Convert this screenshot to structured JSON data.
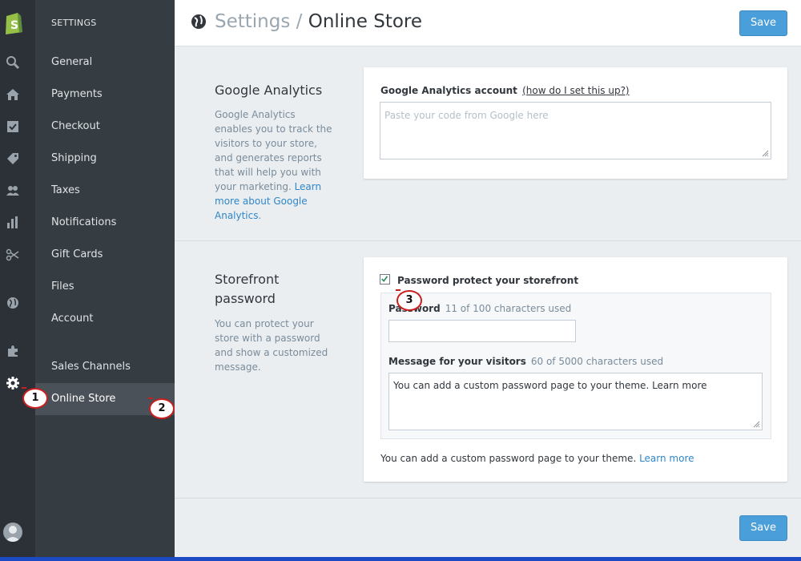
{
  "rail": {
    "icons": [
      "search-icon",
      "home-icon",
      "orders-icon",
      "tag-icon",
      "customers-icon",
      "reports-icon",
      "discounts-icon",
      "globe-icon",
      "puzzle-icon",
      "gear-icon"
    ]
  },
  "nav": {
    "heading": "SETTINGS",
    "items": [
      "General",
      "Payments",
      "Checkout",
      "Shipping",
      "Taxes",
      "Notifications",
      "Gift Cards",
      "Files",
      "Account"
    ],
    "channels_label": "Sales Channels",
    "active_item": "Online Store"
  },
  "header": {
    "crumb_parent": "Settings",
    "crumb_sep": " / ",
    "crumb_current": "Online Store",
    "save_label": "Save"
  },
  "analytics": {
    "title": "Google Analytics",
    "desc_text": "Google Analytics enables you to track the visitors to your store, and generates reports that will help you with your marketing. ",
    "desc_link": "Learn more about Google Analytics",
    "desc_end": ".",
    "account_label": "Google Analytics account",
    "help_link": "(how do I set this up?)",
    "placeholder": "Paste your code from Google here"
  },
  "storefront": {
    "title_line1": "Storefront",
    "title_line2": "password",
    "desc": "You can protect your store with a password and show a customized message.",
    "checkbox_label": "Password protect your storefront",
    "checked": true,
    "password_label": "Password",
    "password_hint": "11 of 100 characters used",
    "password_value": "",
    "message_label": "Message for your visitors",
    "message_hint": "60 of 5000 characters used",
    "message_value": "You can add a custom password page to your theme. Learn more",
    "footer_text": "You can add a custom password page to your theme. ",
    "footer_link": "Learn more"
  },
  "footer": {
    "save_label": "Save"
  },
  "markers": [
    "1",
    "2",
    "3"
  ],
  "colors": {
    "accent": "#4a9ed9",
    "rail": "#2b3136",
    "nav": "#353c42",
    "link": "#2f86c9",
    "marker": "#c91f1f"
  }
}
